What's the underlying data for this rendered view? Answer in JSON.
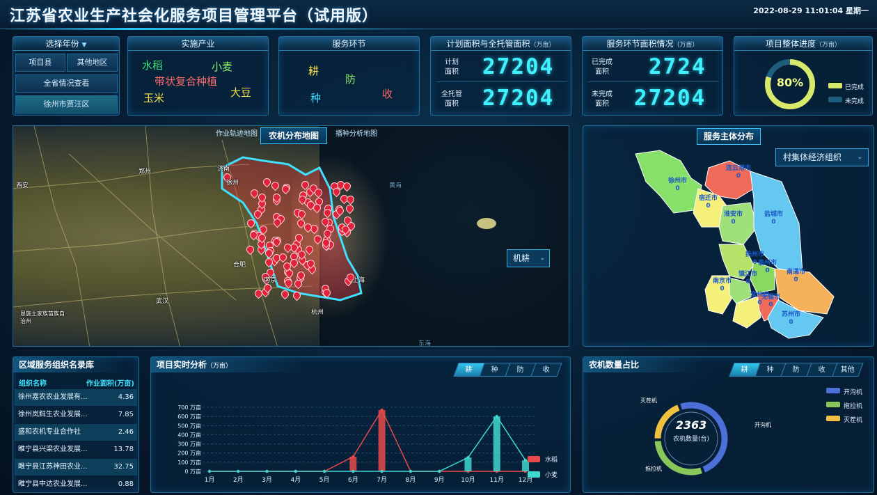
{
  "header": {
    "title": "江苏省农业生产社会化服务项目管理平台（试用版）",
    "datetime": "2022-08-29  11:01:04  星期一"
  },
  "year_panel": {
    "title": "选择年份",
    "buttons": [
      "项目县",
      "其他地区",
      "全省情况查看",
      "徐州市贾汪区"
    ]
  },
  "industry_panel": {
    "title": "实施产业",
    "items": [
      {
        "label": "水稻",
        "color": "#39e07a"
      },
      {
        "label": "小麦",
        "color": "#8ef06a"
      },
      {
        "label": "带状复合种植",
        "color": "#ff6b6b"
      },
      {
        "label": "玉米",
        "color": "#f7e34a"
      },
      {
        "label": "大豆",
        "color": "#f7e34a"
      }
    ]
  },
  "service_panel": {
    "title": "服务环节",
    "items": [
      {
        "label": "耕",
        "color": "#f7e34a"
      },
      {
        "label": "防",
        "color": "#8ef06a"
      },
      {
        "label": "种",
        "color": "#3fd7ff"
      },
      {
        "label": "收",
        "color": "#ff6b6b"
      }
    ]
  },
  "plan_panel": {
    "title": "计划面积与全托管面积",
    "unit": "（万亩）",
    "rows": [
      {
        "label_1": "计划",
        "label_2": "面积",
        "value": "27204"
      },
      {
        "label_1": "全托管",
        "label_2": "面积",
        "value": "27204"
      }
    ]
  },
  "service_area_panel": {
    "title": "服务环节面积情况",
    "unit": "（万亩）",
    "rows": [
      {
        "label_1": "已完成",
        "label_2": "面积",
        "value": "2724"
      },
      {
        "label_1": "未完成",
        "label_2": "面积",
        "value": "27204"
      }
    ]
  },
  "progress_panel": {
    "title": "项目整体进度",
    "unit": "（万亩）",
    "percent_label": "80%",
    "percent": 0.8,
    "legend": [
      {
        "label": "已完成",
        "color": "#d8e86a"
      },
      {
        "label": "未完成",
        "color": "#1f5d7e"
      }
    ]
  },
  "map_panel": {
    "tab_left": "作业轨迹地图",
    "tab_active": "农机分布地图",
    "tab_right": "播种分析地图",
    "dropdown": "机耕",
    "cities": [
      {
        "name": "西安"
      },
      {
        "name": "郑州"
      },
      {
        "name": "济南"
      },
      {
        "name": "合肥"
      },
      {
        "name": "武汉"
      },
      {
        "name": "杭州"
      },
      {
        "name": "南京"
      },
      {
        "name": "上海"
      },
      {
        "name": "黄海"
      },
      {
        "name": "东海"
      },
      {
        "name": "恩施土家族苗族自治州"
      },
      {
        "name": "徐州"
      }
    ]
  },
  "subject_panel": {
    "title": "服务主体分布",
    "dropdown": "村集体经济组织",
    "regions": [
      {
        "name": "徐州市",
        "value": "0"
      },
      {
        "name": "连云港市",
        "value": "0"
      },
      {
        "name": "宿迁市",
        "value": "0"
      },
      {
        "name": "淮安市",
        "value": "0"
      },
      {
        "name": "盐城市",
        "value": "0"
      },
      {
        "name": "扬州市",
        "value": "0"
      },
      {
        "name": "泰州市",
        "value": "0"
      },
      {
        "name": "南通市",
        "value": "0"
      },
      {
        "name": "南京市",
        "value": "0"
      },
      {
        "name": "镇江市",
        "value": "0"
      },
      {
        "name": "常州市",
        "value": "0"
      },
      {
        "name": "无锡市",
        "value": "0"
      },
      {
        "name": "苏州市",
        "value": "0"
      }
    ]
  },
  "org_panel": {
    "title": "区域服务组织名录库",
    "col_name": "组织名称",
    "col_area": "作业面积(万亩)",
    "rows": [
      {
        "name": "徐州嘉农农业发展有...",
        "area": "4.36"
      },
      {
        "name": "徐州岚鲜生农业发展...",
        "area": "7.85"
      },
      {
        "name": "盛和农机专业合作社",
        "area": "2.46"
      },
      {
        "name": "睢宁县兴梁农业发展...",
        "area": "13.78"
      },
      {
        "name": "睢宁县江苏神田农业...",
        "area": "32.75"
      },
      {
        "name": "睢宁县中达农业发展...",
        "area": "0.88"
      }
    ]
  },
  "analysis_panel": {
    "title": "项目实时分析",
    "unit": "（万亩）",
    "tabs": [
      "耕",
      "种",
      "防",
      "收"
    ],
    "active_tab": 0
  },
  "machine_panel": {
    "title": "农机数量占比",
    "tabs": [
      "耕",
      "种",
      "防",
      "收",
      "其他"
    ],
    "active_tab": 0,
    "center_value": "2363",
    "center_label": "农机数量(台)",
    "legend": [
      {
        "label": "开沟机",
        "color": "#4c6fd8"
      },
      {
        "label": "拖拉机",
        "color": "#8ac75a"
      },
      {
        "label": "灭茬机",
        "color": "#f0c040"
      }
    ],
    "callouts": [
      "灭茬机",
      "开沟机",
      "拖拉机"
    ],
    "shares": [
      0.5,
      0.3,
      0.2
    ]
  },
  "chart_data": {
    "type": "line",
    "categories": [
      "1月",
      "2月",
      "3月",
      "4月",
      "5月",
      "6月",
      "7月",
      "8月",
      "9月",
      "10月",
      "11月",
      "12月"
    ],
    "ytick_labels": [
      "0 万亩",
      "100 万亩",
      "200 万亩",
      "300 万亩",
      "400 万亩",
      "500 万亩",
      "600 万亩",
      "700 万亩"
    ],
    "ylim": [
      0,
      700
    ],
    "series": [
      {
        "name": "水稻",
        "color": "#e84a4a",
        "values": [
          0,
          0,
          0,
          0,
          0,
          160,
          670,
          0,
          0,
          0,
          0,
          0
        ]
      },
      {
        "name": "小麦",
        "color": "#3fd7d0",
        "values": [
          0,
          0,
          0,
          0,
          0,
          0,
          0,
          0,
          0,
          150,
          600,
          120
        ]
      }
    ]
  }
}
